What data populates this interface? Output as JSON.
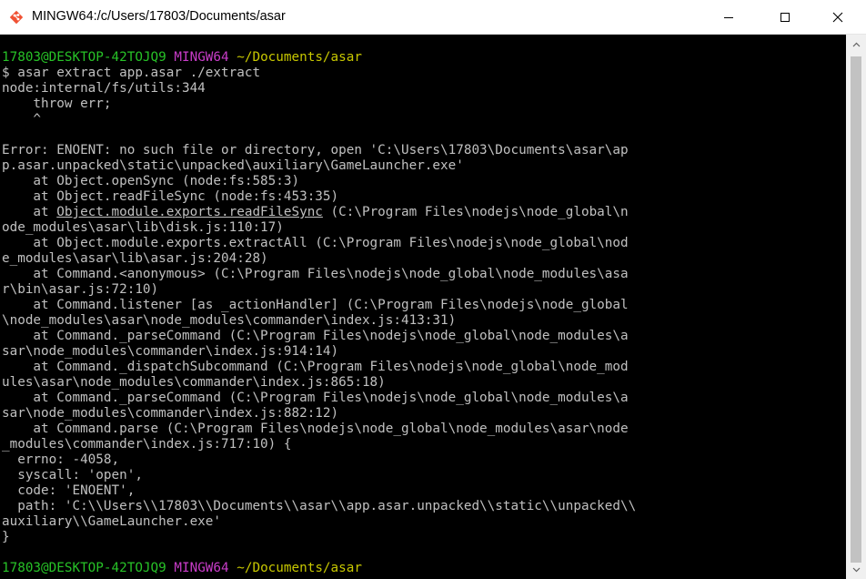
{
  "window": {
    "title": "MINGW64:/c/Users/17803/Documents/asar",
    "app_icon": "git-bash-icon",
    "controls": [
      "minimize-icon",
      "maximize-icon",
      "close-icon"
    ]
  },
  "colors": {
    "terminal_bg": "#000000",
    "text": "#c0c0c0",
    "prompt_user": "#27c227",
    "prompt_env": "#c83cc8",
    "prompt_path": "#c8c800"
  },
  "prompt": {
    "user_host": "17803@DESKTOP-42TOJQ9",
    "env": "MINGW64",
    "path": "~/Documents/asar"
  },
  "command": "$ asar extract app.asar ./extract",
  "output_top": [
    "node:internal/fs/utils:344",
    "    throw err;",
    "    ^",
    "",
    "Error: ENOENT: no such file or directory, open 'C:\\Users\\17803\\Documents\\asar\\ap",
    "p.asar.unpacked\\static\\unpacked\\auxiliary\\GameLauncher.exe'",
    "    at Object.openSync (node:fs:585:3)",
    "    at Object.readFileSync (node:fs:453:35)"
  ],
  "stack_link_line": {
    "prefix": "    at ",
    "link": "Object.module.exports.readFileSync",
    "suffix": " (C:\\Program Files\\nodejs\\node_global\\n"
  },
  "output_bottom": [
    "ode_modules\\asar\\lib\\disk.js:110:17)",
    "    at Object.module.exports.extractAll (C:\\Program Files\\nodejs\\node_global\\nod",
    "e_modules\\asar\\lib\\asar.js:204:28)",
    "    at Command.<anonymous> (C:\\Program Files\\nodejs\\node_global\\node_modules\\asa",
    "r\\bin\\asar.js:72:10)",
    "    at Command.listener [as _actionHandler] (C:\\Program Files\\nodejs\\node_global",
    "\\node_modules\\asar\\node_modules\\commander\\index.js:413:31)",
    "    at Command._parseCommand (C:\\Program Files\\nodejs\\node_global\\node_modules\\a",
    "sar\\node_modules\\commander\\index.js:914:14)",
    "    at Command._dispatchSubcommand (C:\\Program Files\\nodejs\\node_global\\node_mod",
    "ules\\asar\\node_modules\\commander\\index.js:865:18)",
    "    at Command._parseCommand (C:\\Program Files\\nodejs\\node_global\\node_modules\\a",
    "sar\\node_modules\\commander\\index.js:882:12)",
    "    at Command.parse (C:\\Program Files\\nodejs\\node_global\\node_modules\\asar\\node",
    "_modules\\commander\\index.js:717:10) {",
    "  errno: -4058,",
    "  syscall: 'open',",
    "  code: 'ENOENT',",
    "  path: 'C:\\\\Users\\\\17803\\\\Documents\\\\asar\\\\app.asar.unpacked\\\\static\\\\unpacked\\\\",
    "auxiliary\\\\GameLauncher.exe'",
    "}"
  ]
}
